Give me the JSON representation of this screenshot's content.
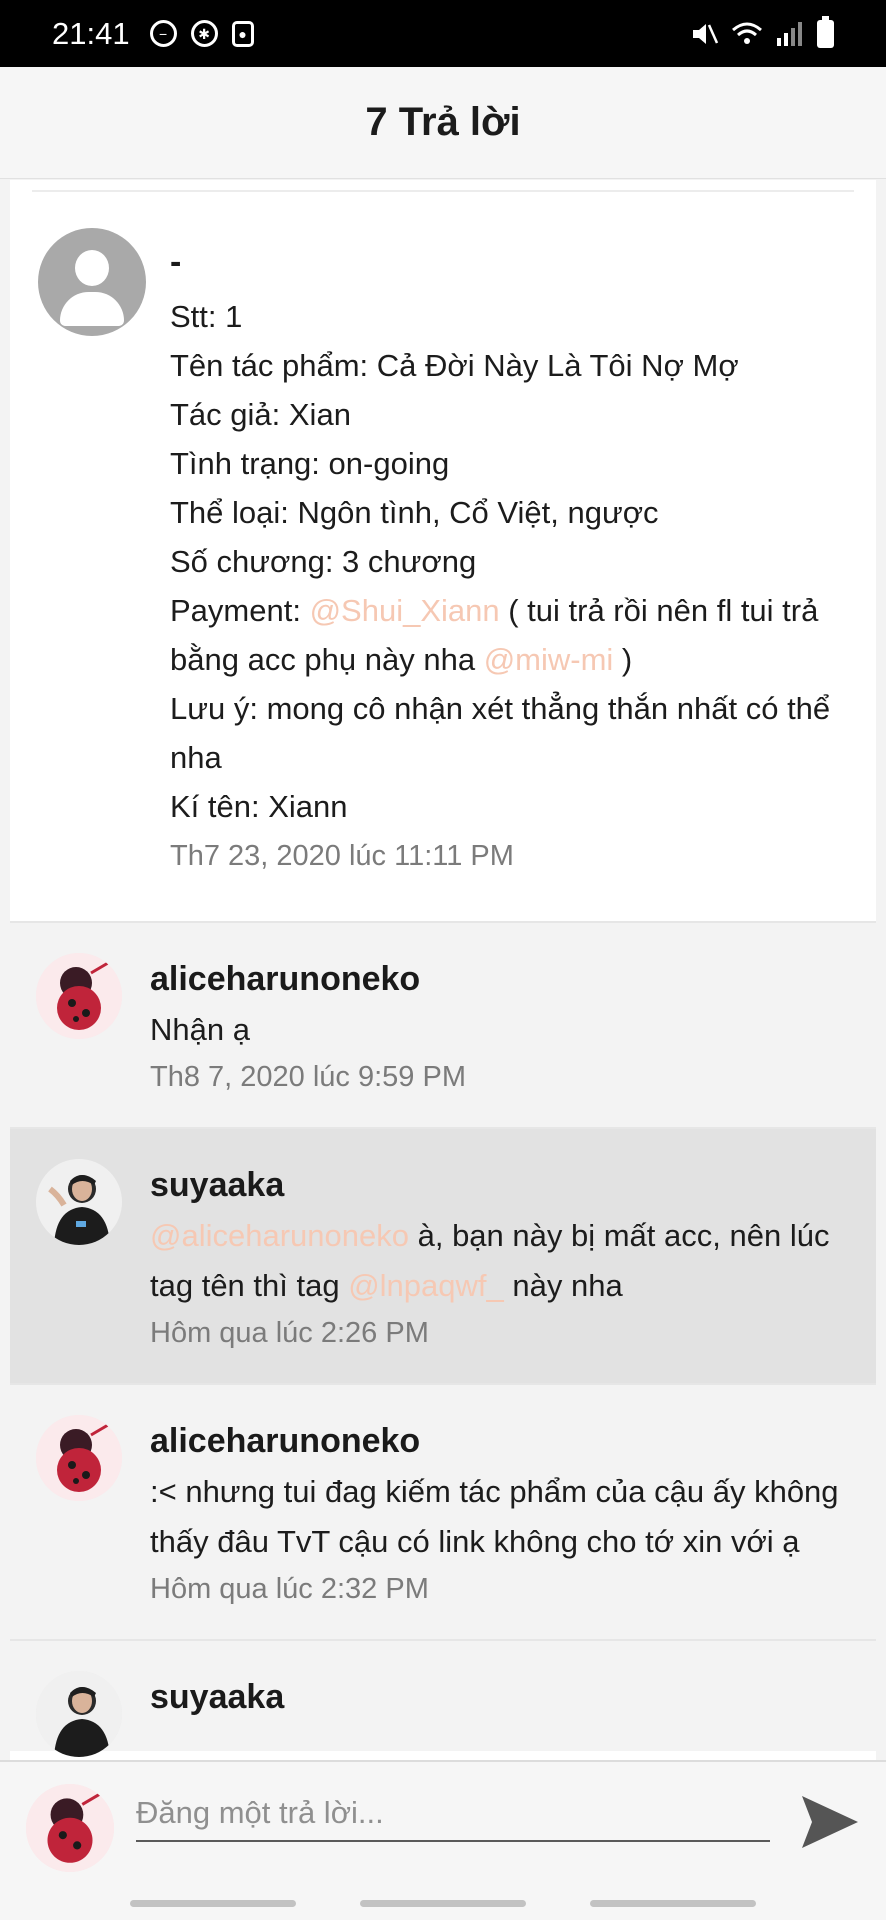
{
  "status_bar": {
    "time": "21:41"
  },
  "header": {
    "title": "7 Trả lời"
  },
  "post": {
    "author": "-",
    "lines": [
      "Stt: 1",
      "Tên tác phẩm: Cả Đời Này Là Tôi Nợ Mợ",
      "Tác giả: Xian",
      "Tình trạng: on-going",
      "Thể loại: Ngôn tình, Cổ Việt, ngược",
      "Số chương: 3 chương"
    ],
    "payment_label": "Payment: ",
    "payment_mention1": "@Shui_Xiann",
    "payment_text1": " ( tui trả rồi nên fl tui trả bằng acc phụ này nha ",
    "payment_mention2": "@miw-mi",
    "payment_text2": " )",
    "note": "Lưu ý: mong cô nhận xét thẳng thắn nhất có thể nha",
    "signature": "Kí tên: Xiann",
    "time": "Th7 23, 2020 lúc 11:11 PM"
  },
  "replies": [
    {
      "author": "aliceharunoneko",
      "text": "Nhận ạ",
      "time": "Th8 7, 2020 lúc 9:59 PM"
    },
    {
      "author": "suyaaka",
      "mention1": "@aliceharunoneko",
      "text1": " à, bạn này bị mất acc, nên lúc tag tên thì tag ",
      "mention2": "@lnpaqwf_",
      "text2": " này nha",
      "time": "Hôm qua lúc 2:26 PM"
    },
    {
      "author": "aliceharunoneko",
      "text": ":< nhưng tui đag kiếm tác phẩm của cậu ấy không thấy đâu TvT cậu có link không cho tớ xin với ạ",
      "time": "Hôm qua lúc 2:32 PM"
    },
    {
      "author": "suyaaka"
    }
  ],
  "compose": {
    "placeholder": "Đăng một trả lời..."
  },
  "colors": {
    "mention": "#f6c8b3",
    "highlight_row": "#e2e2e2",
    "reply_bg": "#f3f3f3"
  }
}
